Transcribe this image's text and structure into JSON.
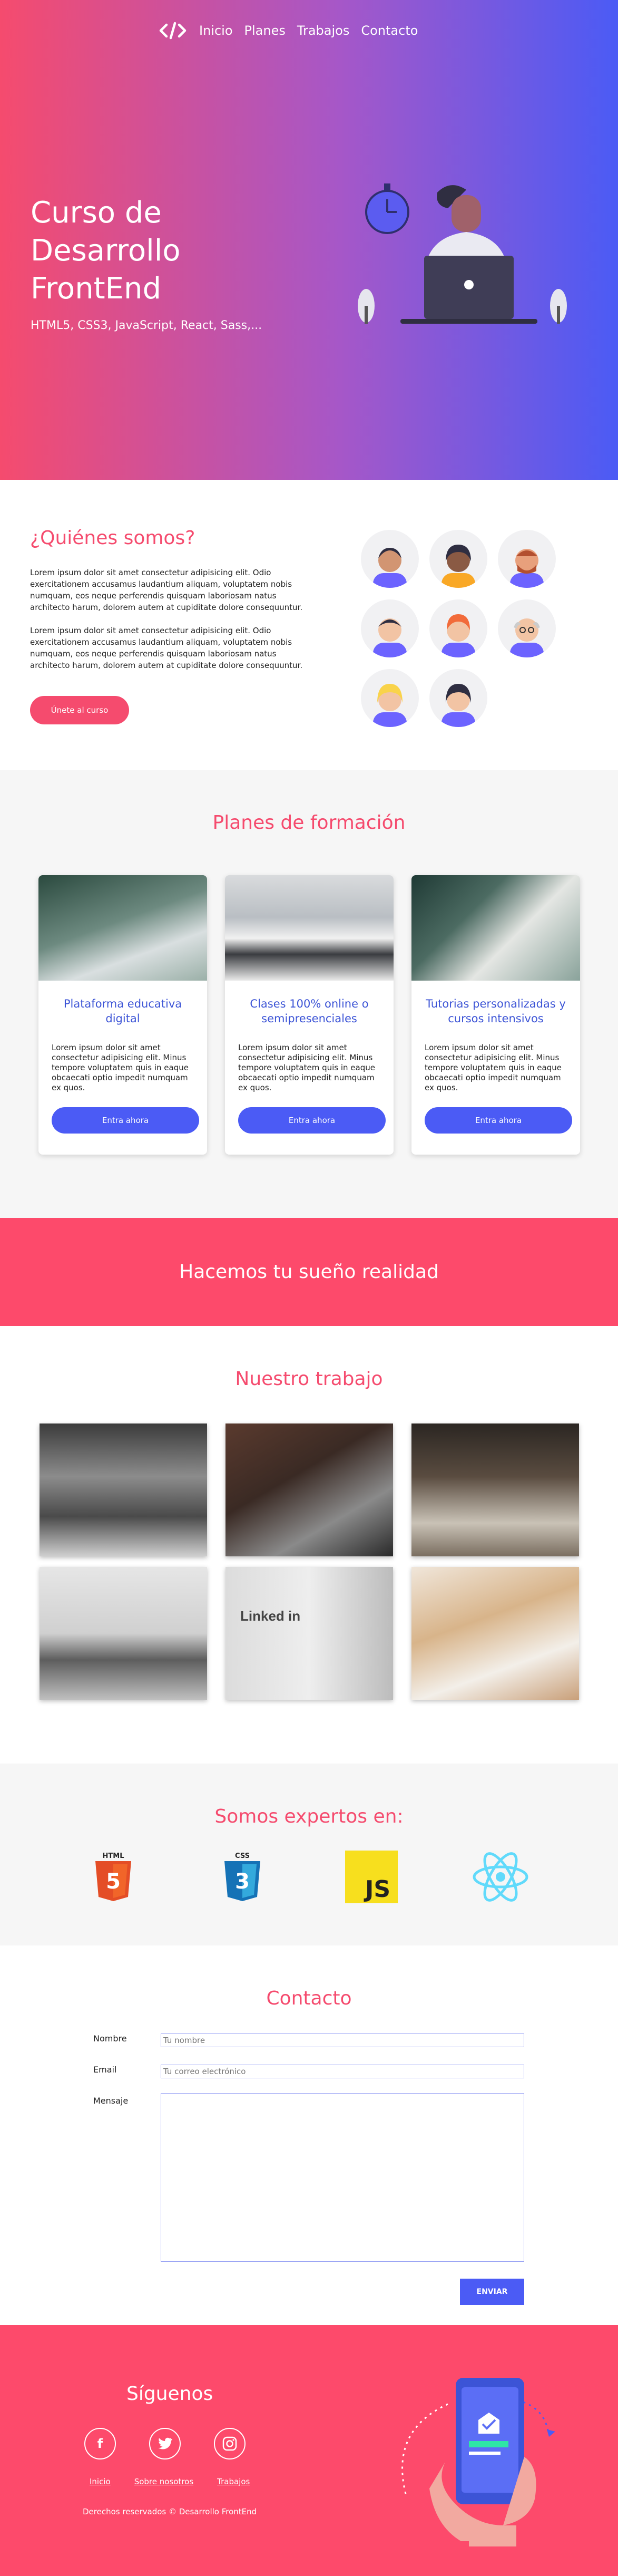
{
  "nav": {
    "items": [
      "Inicio",
      "Planes",
      "Trabajos",
      "Contacto"
    ]
  },
  "hero": {
    "title": "Curso de Desarrollo FrontEnd",
    "subtitle": "HTML5, CSS3, JavaScript, React, Sass,..."
  },
  "about": {
    "title": "¿Quiénes somos?",
    "p1": "Lorem ipsum dolor sit amet consectetur adipisicing elit. Odio exercitationem accusamus laudantium aliquam, voluptatem nobis numquam, eos neque perferendis quisquam laboriosam natus architecto harum, dolorem autem at cupiditate dolore consequuntur.",
    "p2": "Lorem ipsum dolor sit amet consectetur adipisicing elit. Odio exercitationem accusamus laudantium aliquam, voluptatem nobis numquam, eos neque perferendis quisquam laboriosam natus architecto harum, dolorem autem at cupiditate dolore consequuntur.",
    "button": "Únete al curso"
  },
  "plans": {
    "title": "Planes de formación",
    "cards": [
      {
        "title": "Plataforma educativa digital",
        "text": "Lorem ipsum dolor sit amet consectetur adipisicing elit. Minus tempore voluptatem quis in eaque obcaecati optio impedit numquam ex quos.",
        "button": "Entra ahora"
      },
      {
        "title": "Clases 100% online o semipresenciales",
        "text": "Lorem ipsum dolor sit amet consectetur adipisicing elit. Minus tempore voluptatem quis in eaque obcaecati optio impedit numquam ex quos.",
        "button": "Entra ahora"
      },
      {
        "title": "Tutorias personalizadas y cursos intensivos",
        "text": "Lorem ipsum dolor sit amet consectetur adipisicing elit. Minus tempore voluptatem quis in eaque obcaecati optio impedit numquam ex quos.",
        "button": "Entra ahora"
      }
    ]
  },
  "banner": {
    "text": "Hacemos tu sueño realidad"
  },
  "work": {
    "title": "Nuestro trabajo",
    "photo_text": "Linked in"
  },
  "experts": {
    "title": "Somos expertos en:",
    "html_label": "HTML",
    "css_label": "CSS",
    "js_label": "JS"
  },
  "contact": {
    "title": "Contacto",
    "name_label": "Nombre",
    "name_placeholder": "Tu nombre",
    "email_label": "Email",
    "email_placeholder": "Tu correo electrónico",
    "message_label": "Mensaje",
    "send": "ENVIAR"
  },
  "footer": {
    "title": "Síguenos",
    "links": [
      "Inicio",
      "Sobre nosotros",
      "Trabajos"
    ],
    "copyright": "Derechos reservados © Desarrollo FrontEnd"
  },
  "colors": {
    "pink": "#fd4a6b",
    "blue": "#4b5bf5"
  }
}
